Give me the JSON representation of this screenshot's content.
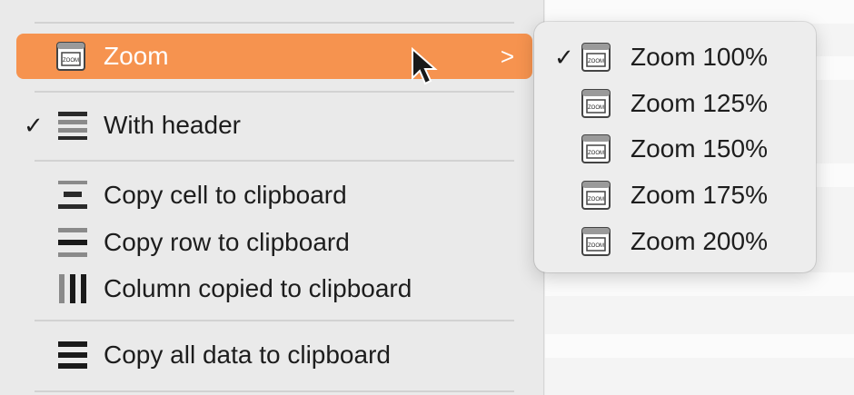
{
  "menu": {
    "zoom": {
      "label": "Zoom",
      "icon": "zoom-window-icon",
      "submenu_indicator": ">"
    },
    "with_header": {
      "label": "With header",
      "checked": true,
      "checkmark": "✓",
      "icon": "table-header-icon"
    },
    "copy_cell": {
      "label": "Copy cell to clipboard",
      "icon": "copy-cell-icon"
    },
    "copy_row": {
      "label": "Copy row to clipboard",
      "icon": "copy-row-icon"
    },
    "column_copied": {
      "label": "Column copied to clipboard",
      "icon": "copy-column-icon"
    },
    "copy_all": {
      "label": "Copy all data to clipboard",
      "icon": "copy-all-icon"
    }
  },
  "submenu": {
    "checkmark": "✓",
    "items": [
      {
        "label": "Zoom 100%",
        "checked": true,
        "icon": "zoom-window-icon"
      },
      {
        "label": "Zoom 125%",
        "checked": false,
        "icon": "zoom-window-icon"
      },
      {
        "label": "Zoom 150%",
        "checked": false,
        "icon": "zoom-window-icon"
      },
      {
        "label": "Zoom 175%",
        "checked": false,
        "icon": "zoom-window-icon"
      },
      {
        "label": "Zoom 200%",
        "checked": false,
        "icon": "zoom-window-icon"
      }
    ]
  },
  "colors": {
    "highlight": "#f6934f",
    "menu_bg": "#eaeaea",
    "text": "#1d1d1d"
  }
}
